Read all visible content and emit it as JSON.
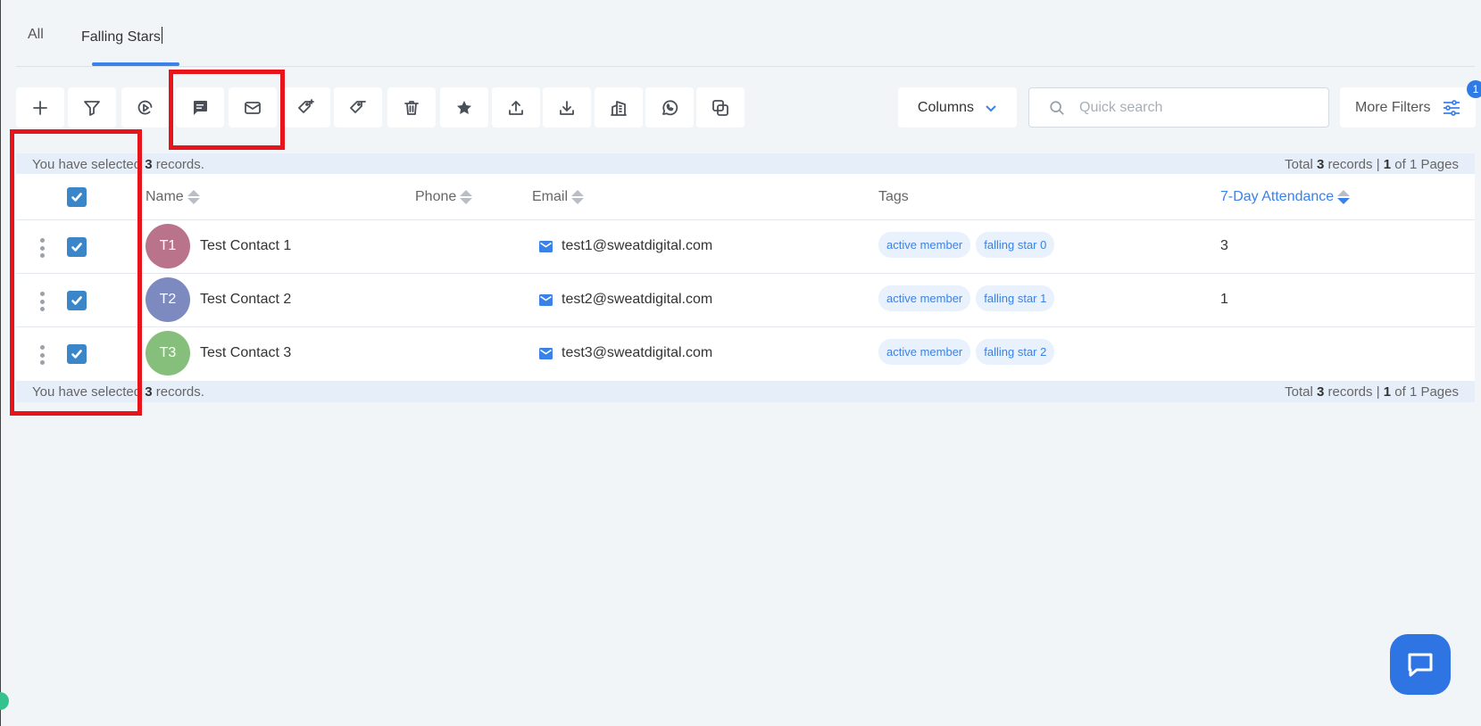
{
  "tabs": [
    {
      "label": "All"
    },
    {
      "label": "Falling Stars"
    }
  ],
  "toolbar": {
    "buttons": [
      "add-icon",
      "filter-icon",
      "automation-icon",
      "message-icon",
      "email-icon",
      "add-tag-icon",
      "remove-tag-icon",
      "trash-icon",
      "star-icon",
      "upload-icon",
      "download-icon",
      "building-icon",
      "whatsapp-icon",
      "duplicate-icon"
    ],
    "columns_label": "Columns",
    "search_placeholder": "Quick search",
    "more_filters_label": "More Filters",
    "filters_badge": "1"
  },
  "selection_bar": {
    "prefix": "You have selected ",
    "count": "3",
    "suffix": " records.",
    "total_prefix": "Total ",
    "total_count": "3",
    "total_mid": " records | ",
    "page": "1",
    "page_suffix": " of 1 Pages"
  },
  "table": {
    "headers": {
      "name": "Name",
      "phone": "Phone",
      "email": "Email",
      "tags": "Tags",
      "attendance": "7-Day Attendance"
    },
    "rows": [
      {
        "initials": "T1",
        "avatar_color": "#b9738a",
        "name": "Test Contact 1",
        "email": "test1@sweatdigital.com",
        "tags": [
          "active member",
          "falling star 0"
        ],
        "attendance": "3"
      },
      {
        "initials": "T2",
        "avatar_color": "#7c8ac0",
        "name": "Test Contact 2",
        "email": "test2@sweatdigital.com",
        "tags": [
          "active member",
          "falling star 1"
        ],
        "attendance": "1"
      },
      {
        "initials": "T3",
        "avatar_color": "#86bf7b",
        "name": "Test Contact 3",
        "email": "test3@sweatdigital.com",
        "tags": [
          "active member",
          "falling star 2"
        ],
        "attendance": ""
      }
    ]
  },
  "colors": {
    "accent": "#3b82e8",
    "checkbox": "#3a86c8",
    "annotation": "#e8141c",
    "chat": "#2f74e3"
  }
}
